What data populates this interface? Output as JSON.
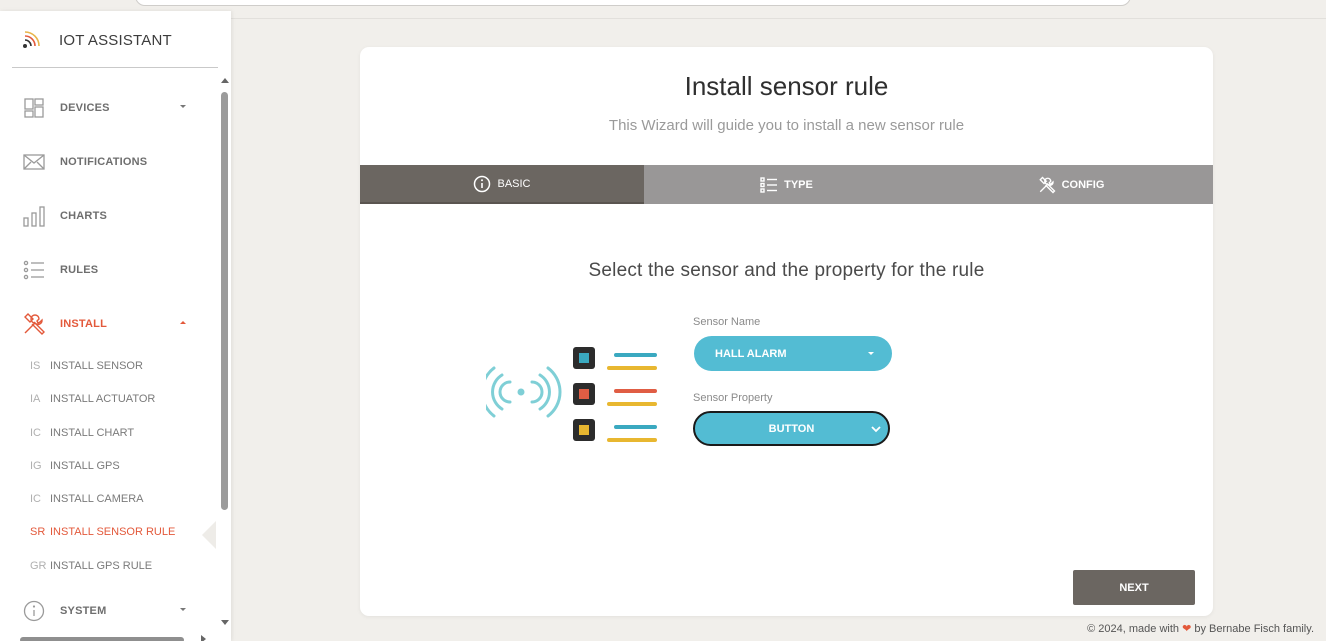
{
  "app": {
    "title": "IOT ASSISTANT"
  },
  "sidebar": {
    "items": [
      {
        "label": "DEVICES",
        "icon": "dashboard-icon"
      },
      {
        "label": "NOTIFICATIONS",
        "icon": "envelope-icon"
      },
      {
        "label": "CHARTS",
        "icon": "bar-chart-icon"
      },
      {
        "label": "RULES",
        "icon": "list-icon"
      },
      {
        "label": "INSTALL",
        "icon": "tools-icon"
      },
      {
        "label": "SYSTEM",
        "icon": "info-icon"
      }
    ],
    "install_sub": [
      {
        "abbr": "IS",
        "label": "INSTALL SENSOR"
      },
      {
        "abbr": "IA",
        "label": "INSTALL ACTUATOR"
      },
      {
        "abbr": "IC",
        "label": "INSTALL CHART"
      },
      {
        "abbr": "IG",
        "label": "INSTALL GPS"
      },
      {
        "abbr": "IC",
        "label": "INSTALL CAMERA"
      },
      {
        "abbr": "SR",
        "label": "INSTALL SENSOR RULE"
      },
      {
        "abbr": "GR",
        "label": "INSTALL GPS RULE"
      }
    ],
    "active_item": "INSTALL",
    "active_sub": "INSTALL SENSOR RULE"
  },
  "wizard": {
    "title": "Install sensor rule",
    "subtitle": "This Wizard will guide you to install a new sensor rule",
    "tabs": [
      {
        "label": "BASIC",
        "icon": "info-circle-icon"
      },
      {
        "label": "TYPE",
        "icon": "list-icon"
      },
      {
        "label": "CONFIG",
        "icon": "tools-icon"
      }
    ],
    "step_title": "Select the sensor and the property for the rule",
    "sensor_name_label": "Sensor Name",
    "sensor_name_value": "HALL ALARM",
    "sensor_property_label": "Sensor Property",
    "sensor_property_value": "BUTTON",
    "next_label": "NEXT"
  },
  "footer": {
    "prefix": "© 2024, made with",
    "suffix": "by Bernabe Fisch family."
  },
  "colors": {
    "accent": "#e3593b",
    "tab_active": "#6b6661",
    "tab_inactive": "#999797",
    "dropdown": "#53bcd3",
    "background": "#f1efeb"
  }
}
